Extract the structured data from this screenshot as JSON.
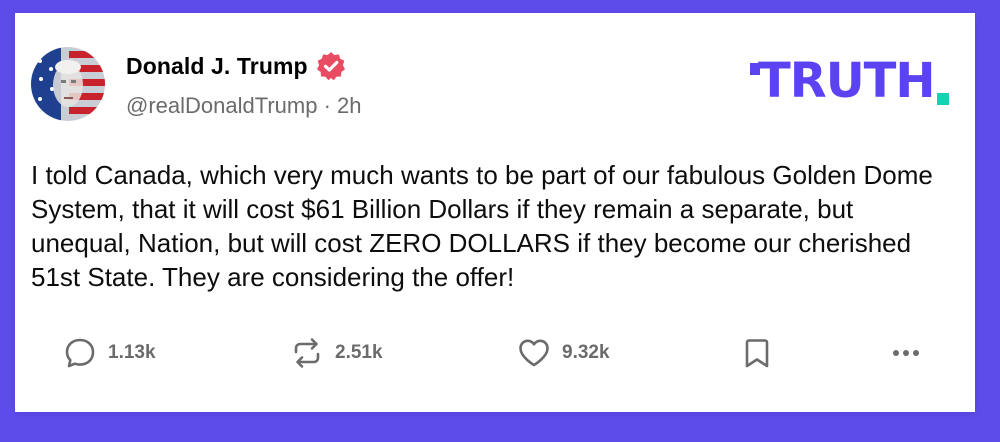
{
  "author": {
    "display_name": "Donald J. Trump",
    "handle": "@realDonaldTrump",
    "separator": " · ",
    "timestamp": "2h",
    "verified": true
  },
  "brand": {
    "logo_text": "TRUTH",
    "accent_color": "#5b43f1",
    "dot_color": "#16d1b2",
    "background_color": "#5d4bea",
    "verified_color": "#e94b62"
  },
  "post": {
    "text": "I told Canada, which very much wants to be part of our fabulous Golden Dome System, that it will cost $61 Billion Dollars if they remain a separate, but unequal, Nation, but will cost ZERO DOLLARS if they become our cherished 51st State. They are considering the offer!"
  },
  "actions": {
    "reply_count": "1.13k",
    "retruth_count": "2.51k",
    "like_count": "9.32k",
    "icons": [
      "reply-icon",
      "retruth-icon",
      "heart-icon",
      "bookmark-icon",
      "more-icon"
    ]
  }
}
